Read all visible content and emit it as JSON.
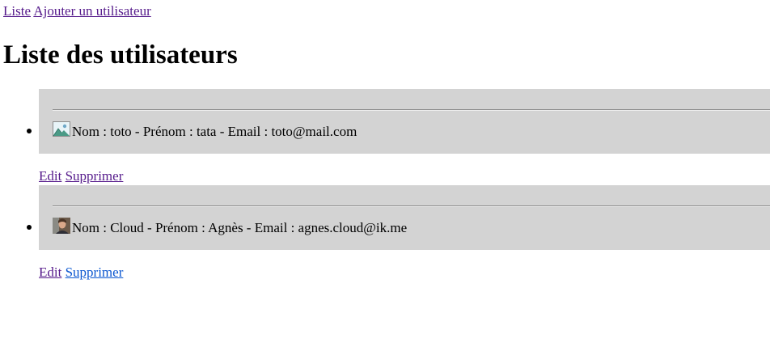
{
  "nav": {
    "list_label": "Liste",
    "add_label": "Ajouter un utilisateur"
  },
  "page_title": "Liste des utilisateurs",
  "users": [
    {
      "text": "Nom : toto - Prénom : tata - Email : toto@mail.com",
      "avatar_icon": "broken-image-icon",
      "edit_label": "Edit",
      "delete_label": "Supprimer"
    },
    {
      "text": "Nom : Cloud - Prénom : Agnès - Email : agnes.cloud@ik.me",
      "avatar_icon": "user-photo-icon",
      "edit_label": "Edit",
      "delete_label": "Supprimer"
    }
  ],
  "colors": {
    "card_background": "#d3d3d3",
    "visited_link": "#551a8b",
    "link": "#0b57d0"
  }
}
